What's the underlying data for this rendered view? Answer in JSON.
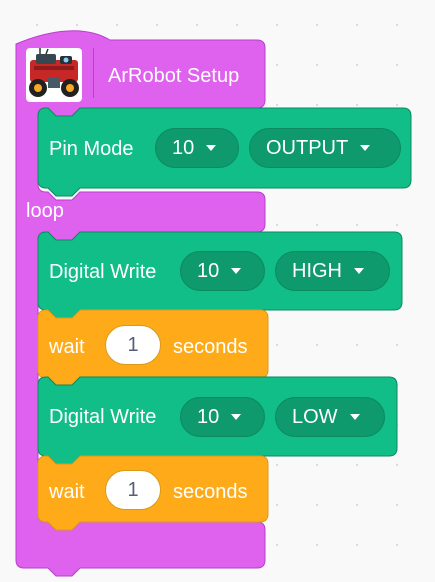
{
  "colors": {
    "hat_block": "#df62ee",
    "hat_block_border": "#b83fcc",
    "io_block": "#11be87",
    "io_block_border": "#0b8a5f",
    "io_field": "#0e9a6c",
    "control_block": "#ffab19",
    "control_block_border": "#d89a1a"
  },
  "setup_block": {
    "icon": "robot-car-icon",
    "title": "ArRobot Setup",
    "pin_mode": {
      "label": "Pin Mode",
      "pin": "10",
      "mode": "OUTPUT"
    },
    "loop_label": "loop"
  },
  "loop_blocks": [
    {
      "type": "digital_write",
      "label": "Digital Write",
      "pin": "10",
      "value": "HIGH"
    },
    {
      "type": "wait",
      "label": "wait",
      "seconds": "1",
      "unit": "seconds"
    },
    {
      "type": "digital_write",
      "label": "Digital Write",
      "pin": "10",
      "value": "LOW"
    },
    {
      "type": "wait",
      "label": "wait",
      "seconds": "1",
      "unit": "seconds"
    }
  ]
}
